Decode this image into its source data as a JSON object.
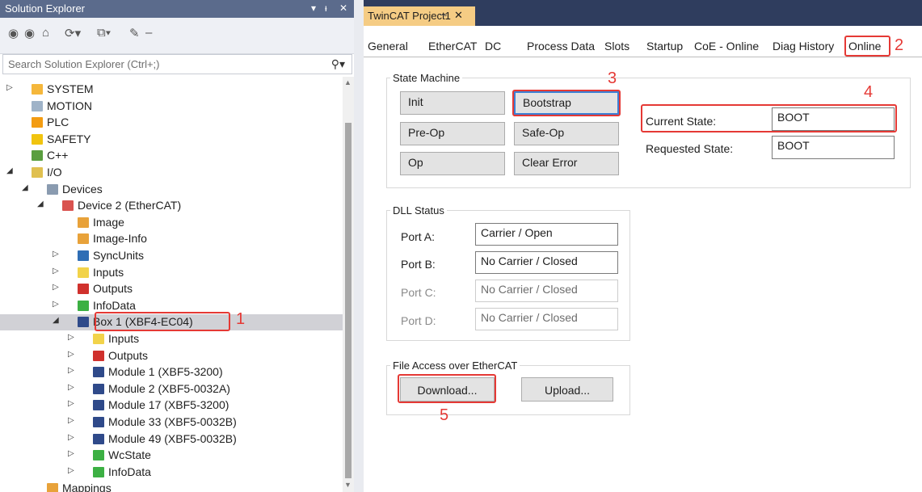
{
  "solution_explorer": {
    "title": "Solution Explorer",
    "search_placeholder": "Search Solution Explorer (Ctrl+;)",
    "tree": [
      {
        "label": "SYSTEM",
        "indent": 0,
        "arrow": "▷",
        "icon": "#f5b73b"
      },
      {
        "label": "MOTION",
        "indent": 0,
        "arrow": "",
        "icon": "#9fb3c8"
      },
      {
        "label": "PLC",
        "indent": 0,
        "arrow": "",
        "icon": "#f39c12"
      },
      {
        "label": "SAFETY",
        "indent": 0,
        "arrow": "",
        "icon": "#f1c40f"
      },
      {
        "label": "C++",
        "indent": 0,
        "arrow": "",
        "icon": "#5a9e3f"
      },
      {
        "label": "I/O",
        "indent": 0,
        "arrow": "◢",
        "icon": "#e0c050"
      },
      {
        "label": "Devices",
        "indent": 1,
        "arrow": "◢",
        "icon": "#8a9bb0"
      },
      {
        "label": "Device 2 (EtherCAT)",
        "indent": 2,
        "arrow": "◢",
        "icon": "#d9534f"
      },
      {
        "label": "Image",
        "indent": 3,
        "arrow": "",
        "icon": "#e8a23a"
      },
      {
        "label": "Image-Info",
        "indent": 3,
        "arrow": "",
        "icon": "#e8a23a"
      },
      {
        "label": "SyncUnits",
        "indent": 3,
        "arrow": "▷",
        "icon": "#2f6eb5"
      },
      {
        "label": "Inputs",
        "indent": 3,
        "arrow": "▷",
        "icon": "#f2d34a"
      },
      {
        "label": "Outputs",
        "indent": 3,
        "arrow": "▷",
        "icon": "#d0312d"
      },
      {
        "label": "InfoData",
        "indent": 3,
        "arrow": "▷",
        "icon": "#3cb043"
      },
      {
        "label": "Box 1 (XBF4-EC04)",
        "indent": 3,
        "arrow": "◢",
        "icon": "#2f4a8a",
        "selected": true
      },
      {
        "label": "Inputs",
        "indent": 4,
        "arrow": "▷",
        "icon": "#f2d34a"
      },
      {
        "label": "Outputs",
        "indent": 4,
        "arrow": "▷",
        "icon": "#d0312d"
      },
      {
        "label": "Module 1 (XBF5-3200)",
        "indent": 4,
        "arrow": "▷",
        "icon": "#2f4a8a"
      },
      {
        "label": "Module 2 (XBF5-0032A)",
        "indent": 4,
        "arrow": "▷",
        "icon": "#2f4a8a"
      },
      {
        "label": "Module 17 (XBF5-3200)",
        "indent": 4,
        "arrow": "▷",
        "icon": "#2f4a8a"
      },
      {
        "label": "Module 33 (XBF5-0032B)",
        "indent": 4,
        "arrow": "▷",
        "icon": "#2f4a8a"
      },
      {
        "label": "Module 49 (XBF5-0032B)",
        "indent": 4,
        "arrow": "▷",
        "icon": "#2f4a8a"
      },
      {
        "label": "WcState",
        "indent": 4,
        "arrow": "▷",
        "icon": "#3cb043"
      },
      {
        "label": "InfoData",
        "indent": 4,
        "arrow": "▷",
        "icon": "#3cb043"
      },
      {
        "label": "Mappings",
        "indent": 1,
        "arrow": "",
        "icon": "#e8a23a"
      }
    ]
  },
  "document": {
    "tab_title": "TwinCAT Project1",
    "tabs": [
      "General",
      "EtherCAT",
      "DC",
      "Process Data",
      "Slots",
      "Startup",
      "CoE - Online",
      "Diag History",
      "Online"
    ],
    "active_tab": "Online"
  },
  "state_machine": {
    "title": "State Machine",
    "buttons": {
      "init": "Init",
      "bootstrap": "Bootstrap",
      "pre_op": "Pre-Op",
      "safe_op": "Safe-Op",
      "op": "Op",
      "clear_error": "Clear Error"
    },
    "current_state_label": "Current State:",
    "current_state": "BOOT",
    "requested_state_label": "Requested State:",
    "requested_state": "BOOT"
  },
  "dll_status": {
    "title": "DLL Status",
    "ports": [
      {
        "label": "Port A:",
        "value": "Carrier / Open",
        "enabled": true
      },
      {
        "label": "Port B:",
        "value": "No Carrier / Closed",
        "enabled": true
      },
      {
        "label": "Port C:",
        "value": "No Carrier / Closed",
        "enabled": false
      },
      {
        "label": "Port D:",
        "value": "No Carrier / Closed",
        "enabled": false
      }
    ]
  },
  "file_access": {
    "title": "File Access over EtherCAT",
    "download": "Download...",
    "upload": "Upload..."
  },
  "annotations": {
    "n1": "1",
    "n2": "2",
    "n3": "3",
    "n4": "4",
    "n5": "5"
  },
  "colors": {
    "annotation": "#e53935",
    "title_bar": "#5b6b8c",
    "doc_tab": "#f5cc84",
    "tab_strip": "#2f3d5e"
  }
}
